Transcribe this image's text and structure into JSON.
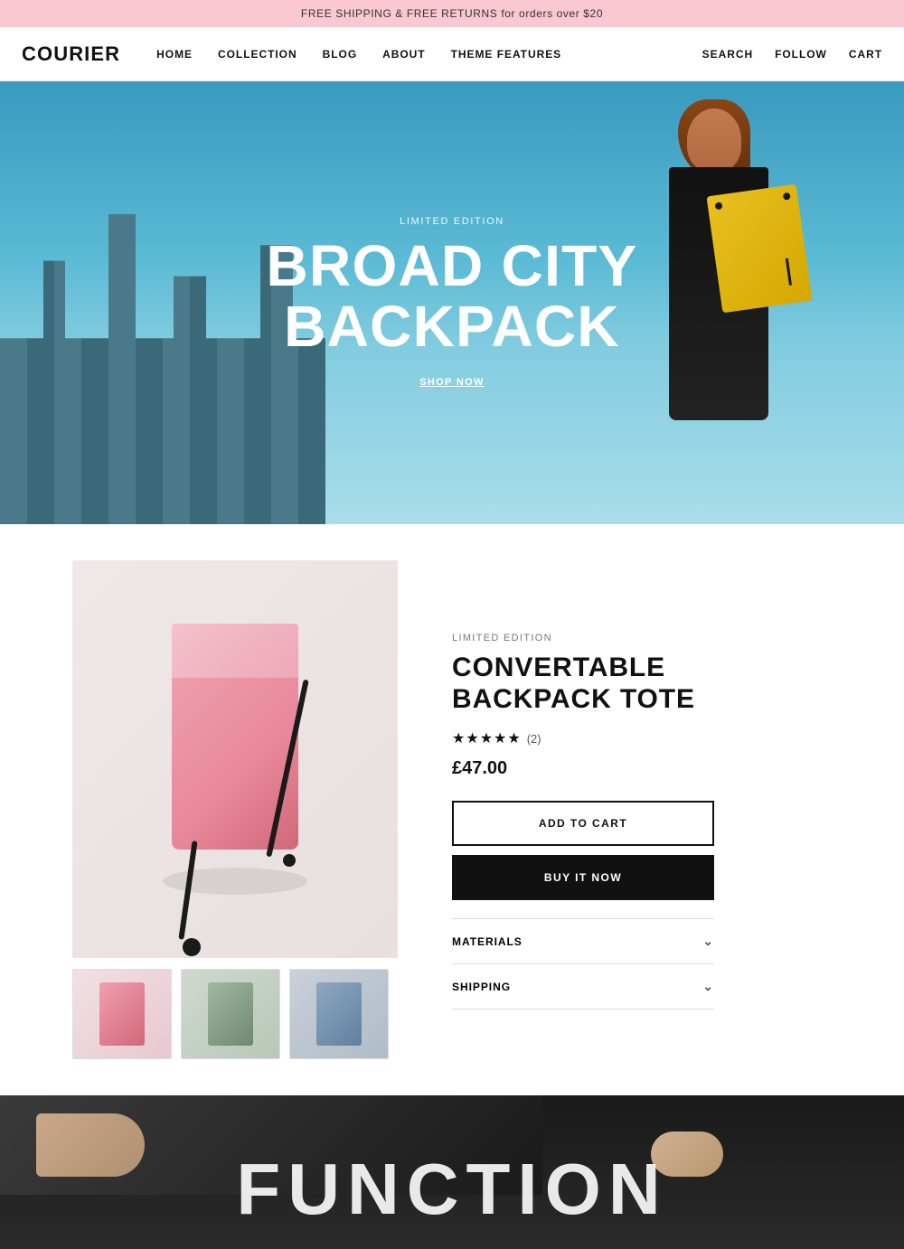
{
  "announcement": {
    "text": "FREE SHIPPING & FREE RETURNS for orders over $20"
  },
  "header": {
    "logo": "COURIER",
    "nav": [
      {
        "label": "HOME",
        "href": "#"
      },
      {
        "label": "COLLECTION",
        "href": "#"
      },
      {
        "label": "BLOG",
        "href": "#"
      },
      {
        "label": "ABOUT",
        "href": "#"
      },
      {
        "label": "THEME FEATURES",
        "href": "#"
      }
    ],
    "right_links": [
      {
        "label": "SEARCH"
      },
      {
        "label": "FOLLOW"
      },
      {
        "label": "CART"
      }
    ]
  },
  "hero": {
    "badge": "LIMITED EDITION",
    "title_line1": "BROAD CITY",
    "title_line2": "BACKPACK",
    "cta": "SHOP NOW"
  },
  "product": {
    "badge": "LIMITED EDITION",
    "title": "CONVERTABLE BACKPACK TOTE",
    "stars": "★★★★★",
    "review_count": "(2)",
    "price": "£47.00",
    "add_to_cart": "ADD TO CART",
    "buy_now": "BUY IT NOW",
    "accordion": [
      {
        "label": "MATERIALS"
      },
      {
        "label": "SHIPPING"
      }
    ]
  },
  "bottom": {
    "heading": "FUNCTION"
  }
}
